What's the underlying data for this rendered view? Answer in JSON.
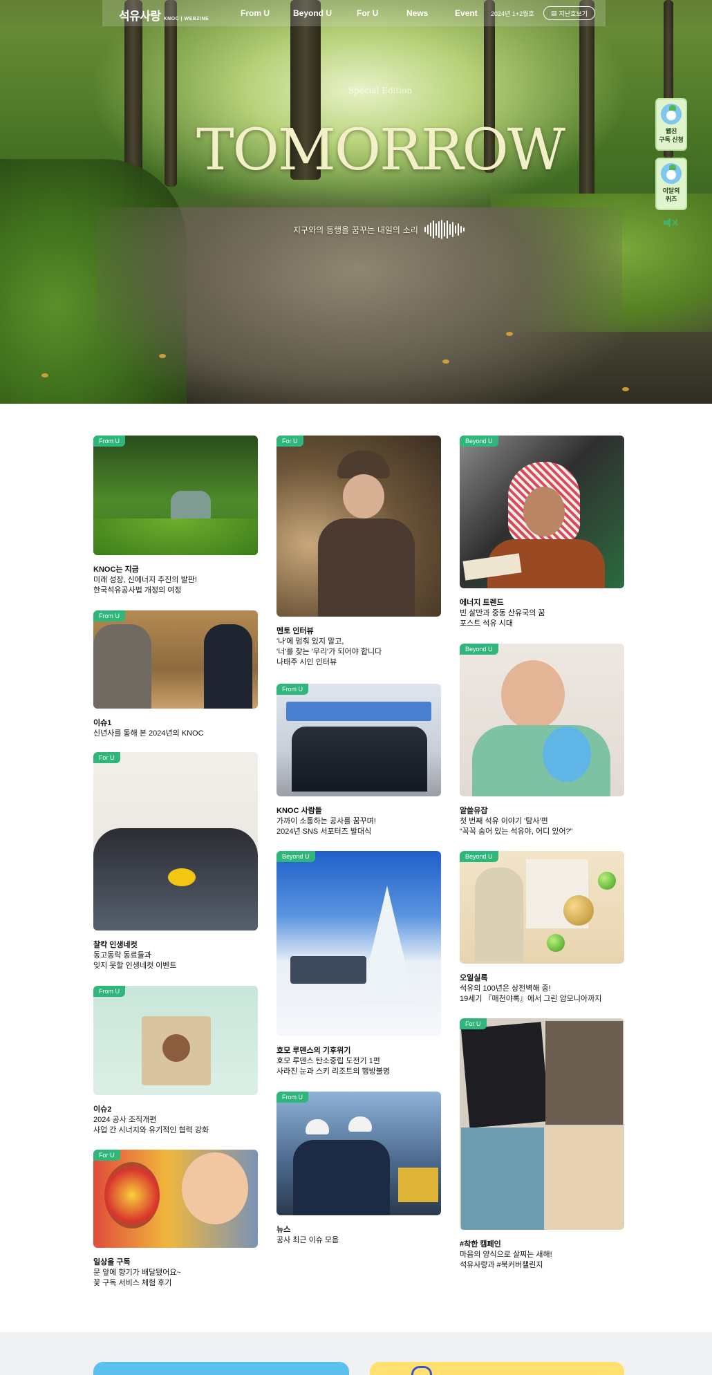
{
  "header": {
    "logo_text": "석유사랑",
    "logo_sub": "KNOC | WEBZINE",
    "nav": [
      "From U",
      "Beyond U",
      "For U",
      "News",
      "Event"
    ],
    "issue": "2024년 1+2월호",
    "past_label": "지난호보기"
  },
  "hero": {
    "subtitle": "Special Edition",
    "title": "TOMORROW",
    "caption": "지구와의 동행을 꿈꾸는 내일의 소리"
  },
  "side": {
    "subscribe_label": "웹진\n구독 신청",
    "quiz_label": "이달의\n퀴즈"
  },
  "colors": {
    "badge": "#2fb67a",
    "side_bg": "#dff3cd",
    "footer_left": "#5cc0ef",
    "footer_right": "#ffe071"
  },
  "cards": [
    {
      "badge": "From U",
      "category": "KNOC는 지금",
      "lines": [
        "미래 성장, 신에너지 추진의 발판!",
        "한국석유공사법 개정의 여정"
      ]
    },
    {
      "badge": "From U",
      "category": "이슈1",
      "lines": [
        "신년사를 통해 본 2024년의 KNOC"
      ]
    },
    {
      "badge": "For U",
      "category": "찰칵 인생네컷",
      "lines": [
        "동고동락 동료들과",
        "잊지 못할 인생네컷 이벤트"
      ]
    },
    {
      "badge": "From U",
      "category": "이슈2",
      "lines": [
        "2024 공사 조직개편",
        "사업 간 시너지와 유기적인 협력 강화"
      ]
    },
    {
      "badge": "For U",
      "category": "일상을 구독",
      "lines": [
        "문 앞에 향기가 배달됐어요~",
        "꽃 구독 서비스 체험 후기"
      ]
    },
    {
      "badge": "For U",
      "category": "멘토 인터뷰",
      "lines": [
        "'나'에 멈춰 있지 말고,",
        "'너'를 찾는 '우리'가 되어야 합니다",
        "나태주 시인 인터뷰"
      ]
    },
    {
      "badge": "From U",
      "category": "KNOC 사람들",
      "lines": [
        "가까이 소통하는 공사를 꿈꾸며!",
        "2024년 SNS 서포터즈 발대식"
      ]
    },
    {
      "badge": "Beyond U",
      "category": "호모 루덴스의 기후위기",
      "lines": [
        "호모 루덴스 탄소중립 도전기 1편",
        "사라진 눈과 스키 리조트의 행방불명"
      ]
    },
    {
      "badge": "From U",
      "category": "뉴스",
      "lines": [
        "공사 최근 이슈 모음"
      ]
    },
    {
      "badge": "Beyond U",
      "category": "에너지 트렌드",
      "lines": [
        "빈 살만과 중동 산유국의 꿈",
        "포스트 석유 시대"
      ]
    },
    {
      "badge": "Beyond U",
      "category": "알쓸유잡",
      "lines": [
        "첫 번째 석유 이야기 '탐사'편",
        "“꼭꼭 숨어 있는 석유야, 어디 있어?”"
      ]
    },
    {
      "badge": "Beyond U",
      "category": "오일실록",
      "lines": [
        "석유의 100년은 상전벽해 중!",
        "19세기 『매천야록』에서 그린 암모니아까지"
      ]
    },
    {
      "badge": "For U",
      "category": "#착한 캠페인",
      "lines": [
        "마음의 양식으로 살찌는 새해!",
        "석유사랑과 #북커버챌린지"
      ]
    }
  ]
}
